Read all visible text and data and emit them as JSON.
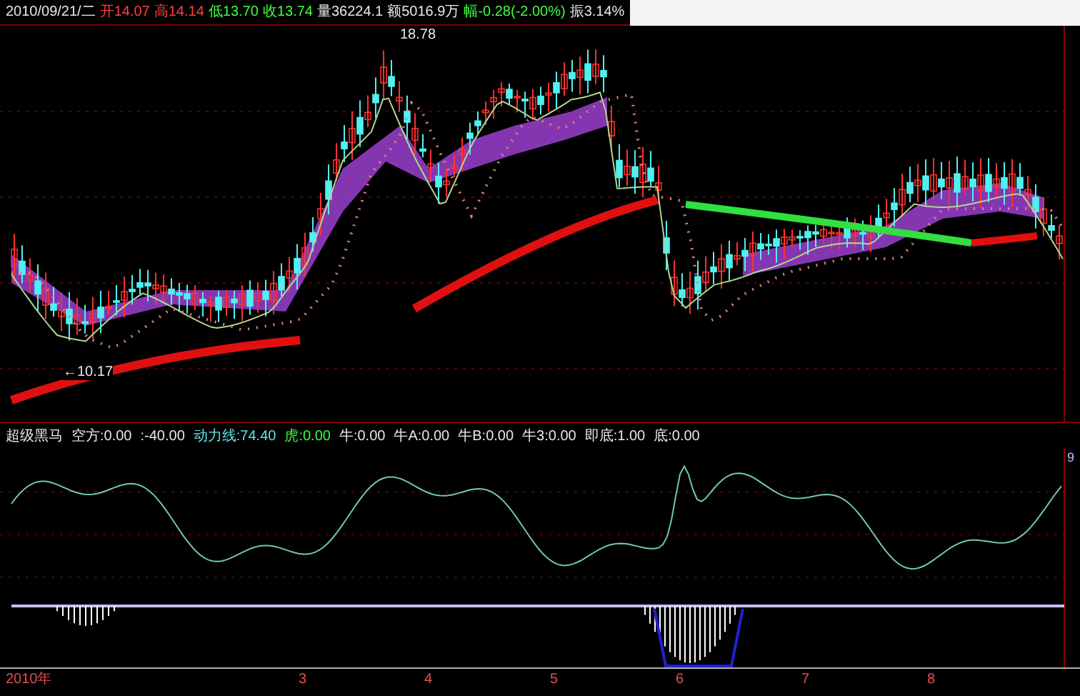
{
  "header": {
    "date": "2010/09/21/二",
    "fields": [
      {
        "text": "开14.07",
        "color": "#ff4040"
      },
      {
        "text": "高14.14",
        "color": "#ff4040"
      },
      {
        "text": "低13.70",
        "color": "#40ff40"
      },
      {
        "text": "收13.74",
        "color": "#40ff40"
      },
      {
        "text": "量36224.1",
        "color": "#e8e8e8"
      },
      {
        "text": "额5016.9万",
        "color": "#e8e8e8"
      },
      {
        "text": "幅-0.28(-2.00%)",
        "color": "#40ff40"
      },
      {
        "text": "振3.14%",
        "color": "#e8e8e8"
      }
    ]
  },
  "price_chart": {
    "high_label": "18.78",
    "low_label": "←10.17"
  },
  "indicator": {
    "name": "超级黑马",
    "items": [
      {
        "text": "空方:0.00",
        "color": "#e8e8e8"
      },
      {
        "text": ":-40.00",
        "color": "#e8e8e8"
      },
      {
        "text": "动力线:74.40",
        "color": "#60e0e0"
      },
      {
        "text": "虎:0.00",
        "color": "#40ff40"
      },
      {
        "text": "牛:0.00",
        "color": "#e8e8e8"
      },
      {
        "text": "牛A:0.00",
        "color": "#e8e8e8"
      },
      {
        "text": "牛B:0.00",
        "color": "#e8e8e8"
      },
      {
        "text": "牛3:0.00",
        "color": "#e8e8e8"
      },
      {
        "text": "即底:1.00",
        "color": "#e8e8e8"
      },
      {
        "text": "底:0.00",
        "color": "#e8e8e8"
      }
    ],
    "scale_mark": "9"
  },
  "time_axis": [
    "2010年",
    "3",
    "4",
    "5",
    "6",
    "7",
    "8"
  ]
}
